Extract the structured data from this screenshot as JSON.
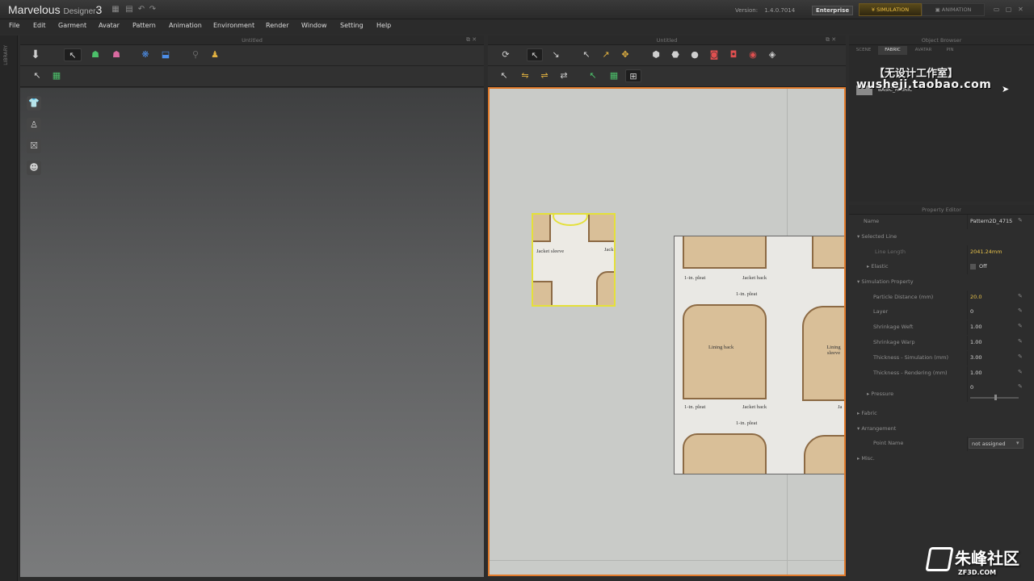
{
  "titlebar": {
    "logo_main": "Marvelous",
    "logo_sub": "Designer",
    "logo_num": "3",
    "version_label": "Version:",
    "version_number": "1.4.0.7014",
    "edition": "Enterprise",
    "mode_simulation": "SIMULATION",
    "mode_animation": "ANIMATION"
  },
  "menu": [
    "File",
    "Edit",
    "Garment",
    "Avatar",
    "Pattern",
    "Animation",
    "Environment",
    "Render",
    "Window",
    "Setting",
    "Help"
  ],
  "library_label": "LIBRARY",
  "panels": {
    "view3d_title": "Untitled",
    "view2d_title": "Untitled",
    "object_browser_title": "Object Browser",
    "property_editor_title": "Property Editor"
  },
  "object_browser": {
    "tabs": [
      "SCENE",
      "FABRIC",
      "AVATAR",
      "PIN"
    ],
    "selected_tab": "FABRIC",
    "fabric_item": "BASIC_FABRIC"
  },
  "watermarks": {
    "shop_cn": "【无设计工作室】",
    "shop_url": "wusheji.taobao.com",
    "site_cn": "朱峰社区",
    "site_url": "ZF3D.COM"
  },
  "pattern_labels": {
    "jacket_sleeve": "Jacket sleeve",
    "jack_partial": "Jack",
    "pleat": "1-in. pleat",
    "jacket_back": "Jacket back",
    "lining_back": "Lining back",
    "lining_sleeve": "Lining sleeve",
    "ja_partial": "Ja"
  },
  "property_editor": {
    "name_label": "Name",
    "name_value": "Pattern2D_4715",
    "selected_line": "Selected Line",
    "line_length_label": "Line Length",
    "line_length_value": "2041.24mm",
    "elastic_label": "Elastic",
    "elastic_value": "Off",
    "simulation_property": "Simulation Property",
    "particle_distance_label": "Particle Distance (mm)",
    "particle_distance_value": "20.0",
    "layer_label": "Layer",
    "layer_value": "0",
    "shrinkage_weft_label": "Shrinkage Weft",
    "shrinkage_weft_value": "1.00",
    "shrinkage_warp_label": "Shrinkage Warp",
    "shrinkage_warp_value": "1.00",
    "thickness_sim_label": "Thickness - Simulation (mm)",
    "thickness_sim_value": "3.00",
    "thickness_render_label": "Thickness - Rendering (mm)",
    "thickness_render_value": "1.00",
    "pressure_label": "Pressure",
    "pressure_value": "0",
    "fabric_section": "Fabric",
    "arrangement_section": "Arrangement",
    "point_name_label": "Point Name",
    "point_name_value": "not assigned",
    "misc_section": "Misc."
  },
  "colors": {
    "accent_orange": "#e17a2a",
    "selection_yellow": "#e4e03a",
    "value_gold": "#e8c24a"
  }
}
